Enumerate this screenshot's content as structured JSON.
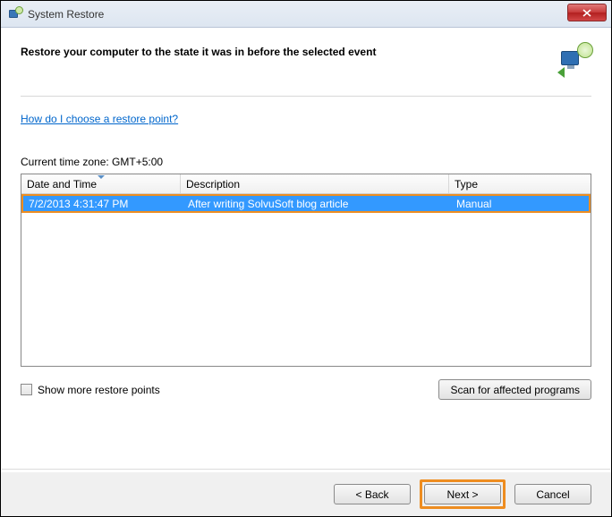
{
  "window": {
    "title": "System Restore"
  },
  "heading": "Restore your computer to the state it was in before the selected event",
  "help_link": "How do I choose a restore point?",
  "timezone_label": "Current time zone: GMT+5:00",
  "table": {
    "headers": {
      "date": "Date and Time",
      "desc": "Description",
      "type": "Type"
    },
    "rows": [
      {
        "date": "7/2/2013 4:31:47 PM",
        "desc": "After writing SolvuSoft blog article",
        "type": "Manual"
      }
    ]
  },
  "show_more_label": "Show more restore points",
  "scan_button": "Scan for affected programs",
  "footer": {
    "back": "< Back",
    "next": "Next >",
    "cancel": "Cancel"
  }
}
